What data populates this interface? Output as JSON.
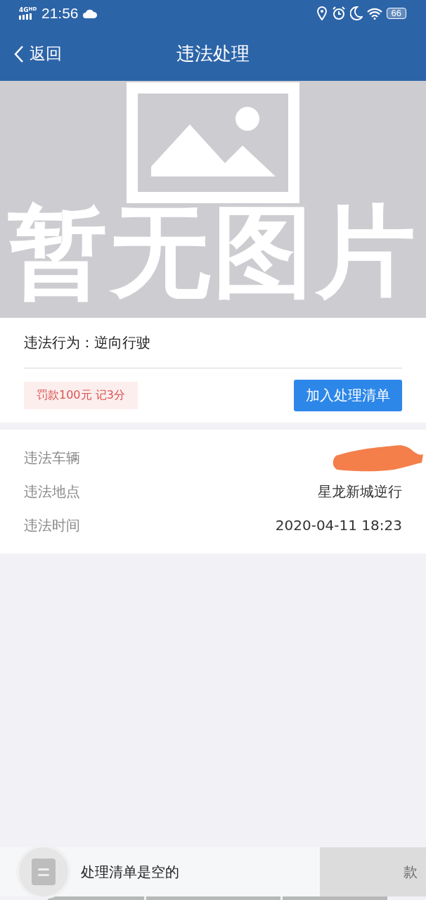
{
  "status_bar": {
    "network": "4G",
    "network_badge": "HD",
    "time": "21:56",
    "battery": "66"
  },
  "nav": {
    "back": "返回",
    "title": "违法处理"
  },
  "image": {
    "kind": "picture",
    "placeholder_text": "暂无图片"
  },
  "violation": {
    "label": "违法行为：",
    "value": "逆向行驶",
    "penalty": "罚款100元 记3分",
    "action": "加入处理清单"
  },
  "details": [
    {
      "label": "违法车辆",
      "redacted": true
    },
    {
      "label": "违法地点",
      "value": "星龙新城逆行",
      "redacted": false
    },
    {
      "label": "违法时间",
      "value": "2020-04-11 18:23",
      "redacted": false
    }
  ],
  "bottom_bar": {
    "message": "处理清单是空的",
    "button": "款",
    "button_disabled": true
  }
}
